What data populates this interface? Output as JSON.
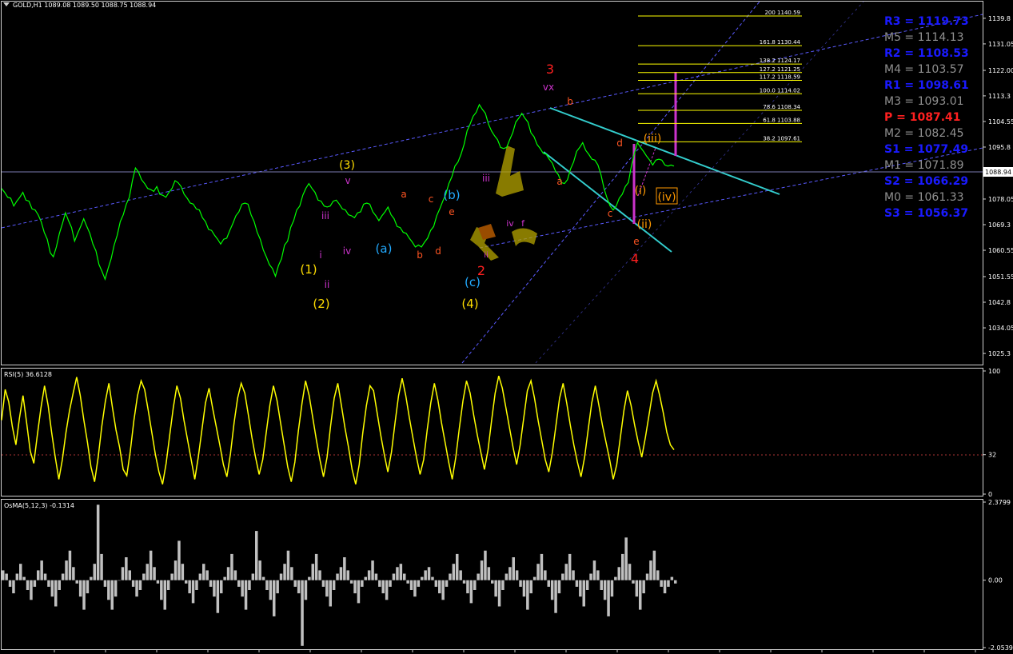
{
  "chart_data": [
    {
      "type": "line",
      "panel": "price",
      "title": "GOLD,H1  1089.08 1089.50 1088.75 1088.94",
      "symbol": "GOLD",
      "timeframe": "H1",
      "ohlc": {
        "open": 1089.08,
        "high": 1089.5,
        "low": 1088.75,
        "close": 1088.94
      },
      "ylim": [
        1021.5,
        1145.5
      ],
      "y_ticks": [
        1139.8,
        1131.05,
        1122.0,
        1113.3,
        1104.55,
        1095.8,
        1086.8,
        1078.05,
        1069.3,
        1060.55,
        1051.55,
        1042.8,
        1034.05,
        1025.3
      ],
      "y_tick_labels": [
        "1139.8",
        "1131.05",
        "1122.00",
        "1113.3",
        "1104.55",
        "1095.8",
        "1086.8",
        "1078.05",
        "1069.3",
        "1060.55",
        "1051.55",
        "1042.8",
        "1034.05",
        "1025.3"
      ],
      "current_price_label": "1088.94",
      "current_price": 1088.94,
      "series": [
        {
          "color": "#00ff00",
          "values": [
            1082,
            1080,
            1079,
            1078,
            1076,
            1077,
            1079,
            1080,
            1078,
            1077,
            1075,
            1074,
            1073,
            1070,
            1067,
            1064,
            1060,
            1058,
            1062,
            1066,
            1070,
            1073,
            1071,
            1068,
            1064,
            1066,
            1069,
            1071,
            1069,
            1066,
            1063,
            1060,
            1056,
            1053,
            1051,
            1054,
            1058,
            1062,
            1066,
            1070,
            1073,
            1076,
            1079,
            1084,
            1089,
            1087,
            1085,
            1083,
            1082,
            1081,
            1081,
            1082,
            1080,
            1079,
            1079,
            1080,
            1082,
            1084,
            1084,
            1082,
            1080,
            1078,
            1077,
            1076,
            1075,
            1074,
            1072,
            1070,
            1068,
            1067,
            1066,
            1064,
            1063,
            1064,
            1065,
            1067,
            1070,
            1072,
            1074,
            1076,
            1077,
            1076,
            1073,
            1070,
            1067,
            1064,
            1061,
            1058,
            1056,
            1054,
            1052,
            1055,
            1058,
            1062,
            1064,
            1068,
            1071,
            1074,
            1076,
            1079,
            1082,
            1083,
            1082,
            1080,
            1078,
            1077,
            1076,
            1075,
            1076,
            1077,
            1078,
            1076,
            1075,
            1074,
            1073,
            1072,
            1072,
            1073,
            1074,
            1076,
            1077,
            1076,
            1074,
            1072,
            1071,
            1072,
            1074,
            1075,
            1073,
            1071,
            1069,
            1068,
            1067,
            1066,
            1065,
            1063,
            1062,
            1062,
            1062,
            1063,
            1065,
            1067,
            1069,
            1072,
            1075,
            1077,
            1080,
            1083,
            1086,
            1089,
            1091,
            1093,
            1097,
            1101,
            1104,
            1106,
            1108,
            1110,
            1109,
            1107,
            1104,
            1101,
            1100,
            1098,
            1096,
            1095,
            1096,
            1098,
            1101,
            1104,
            1106,
            1107,
            1106,
            1104,
            1101,
            1099,
            1097,
            1095,
            1094,
            1093,
            1092,
            1090,
            1088,
            1086,
            1084,
            1083,
            1085,
            1088,
            1091,
            1094,
            1096,
            1097,
            1095,
            1093,
            1092,
            1091,
            1090,
            1086,
            1082,
            1078,
            1076,
            1074,
            1076,
            1078,
            1080,
            1082,
            1084,
            1089,
            1094,
            1097,
            1096,
            1094,
            1093,
            1091,
            1090,
            1091,
            1092,
            1091,
            1090,
            1089,
            1090,
            1089
          ]
        }
      ],
      "fibonacci_levels": [
        {
          "ratio": "200",
          "price": 1140.59
        },
        {
          "ratio": "161.8",
          "price": 1130.44
        },
        {
          "ratio": "138.2",
          "price": 1124.17
        },
        {
          "ratio": "127.2",
          "price": 1121.25
        },
        {
          "ratio": "117.2",
          "price": 1118.59
        },
        {
          "ratio": "100.0",
          "price": 1114.02
        },
        {
          "ratio": "78.6",
          "price": 1108.34
        },
        {
          "ratio": "61.8",
          "price": 1103.88
        },
        {
          "ratio": "38.2",
          "price": 1097.61
        }
      ],
      "fib_line_color": "#ffff00",
      "pivot_levels": [
        {
          "label": "R3",
          "value": "1119.73",
          "color": "#1a1aff"
        },
        {
          "label": "M5",
          "value": "1114.13",
          "color": "#909090"
        },
        {
          "label": "R2",
          "value": "1108.53",
          "color": "#1a1aff"
        },
        {
          "label": "M4",
          "value": "1103.57",
          "color": "#909090"
        },
        {
          "label": "R1",
          "value": "1098.61",
          "color": "#1a1aff"
        },
        {
          "label": "M3",
          "value": "1093.01",
          "color": "#909090"
        },
        {
          "label": "P",
          "value": "1087.41",
          "color": "#ff2020"
        },
        {
          "label": "M2",
          "value": "1082.45",
          "color": "#909090"
        },
        {
          "label": "S1",
          "value": "1077.49",
          "color": "#1a1aff"
        },
        {
          "label": "M1",
          "value": "1071.89",
          "color": "#909090"
        },
        {
          "label": "S2",
          "value": "1066.29",
          "color": "#1a1aff"
        },
        {
          "label": "M0",
          "value": "1061.33",
          "color": "#909090"
        },
        {
          "label": "S3",
          "value": "1056.37",
          "color": "#1a1aff"
        }
      ],
      "wave_labels": [
        {
          "text": "3",
          "color": "#ff2020"
        },
        {
          "text": "vx",
          "color": "#cc33cc"
        },
        {
          "text": "b",
          "color": "#ff5522"
        },
        {
          "text": "(3)",
          "color": "#ffdd00"
        },
        {
          "text": "v",
          "color": "#cc33cc"
        },
        {
          "text": "a",
          "color": "#ff5522"
        },
        {
          "text": "c",
          "color": "#ff5522"
        },
        {
          "text": "(b)",
          "color": "#22aaff"
        },
        {
          "text": "e",
          "color": "#ff5522"
        },
        {
          "text": "iii",
          "color": "#cc33cc"
        },
        {
          "text": "iii",
          "color": "#cc33cc"
        },
        {
          "text": "a",
          "color": "#ff5522"
        },
        {
          "text": "d",
          "color": "#ff5522"
        },
        {
          "text": "(iii)",
          "color": "#ff9900"
        },
        {
          "text": "i",
          "color": "#cc33cc"
        },
        {
          "text": "iv",
          "color": "#cc33cc"
        },
        {
          "text": "(a)",
          "color": "#22aaff"
        },
        {
          "text": "b",
          "color": "#ff5522"
        },
        {
          "text": "d",
          "color": "#ff5522"
        },
        {
          "text": "iv",
          "color": "#cc33cc"
        },
        {
          "text": "f",
          "color": "#cc33cc"
        },
        {
          "text": "(i)",
          "color": "#ff9900"
        },
        {
          "text": "(iv)",
          "color": "#ff9900"
        },
        {
          "text": "c",
          "color": "#ff5522"
        },
        {
          "text": "(ii)",
          "color": "#ff9900"
        },
        {
          "text": "e",
          "color": "#ff5522"
        },
        {
          "text": "4",
          "color": "#ff2020"
        },
        {
          "text": "(1)",
          "color": "#ffdd00"
        },
        {
          "text": "ii",
          "color": "#cc33cc"
        },
        {
          "text": "2",
          "color": "#ff2020"
        },
        {
          "text": "ii",
          "color": "#cc33cc"
        },
        {
          "text": "(c)",
          "color": "#22aaff"
        },
        {
          "text": "(2)",
          "color": "#ffdd00"
        },
        {
          "text": "(4)",
          "color": "#ffdd00"
        }
      ]
    },
    {
      "type": "line",
      "panel": "rsi",
      "title": "RSI(5) 36.6128",
      "period": 5,
      "current_value": 36.6128,
      "ylim": [
        0,
        100
      ],
      "y_tick_labels": [
        "100",
        "32",
        "0"
      ],
      "level": 32,
      "level_label": "32",
      "series": [
        {
          "color": "#ffff00",
          "values": [
            60,
            85,
            75,
            55,
            40,
            62,
            80,
            58,
            35,
            25,
            48,
            70,
            88,
            72,
            50,
            30,
            12,
            28,
            50,
            68,
            82,
            95,
            80,
            60,
            42,
            22,
            10,
            30,
            55,
            75,
            90,
            70,
            52,
            38,
            20,
            15,
            35,
            60,
            80,
            92,
            85,
            68,
            50,
            32,
            18,
            8,
            25,
            48,
            70,
            88,
            78,
            60,
            44,
            28,
            12,
            30,
            52,
            74,
            86,
            70,
            55,
            40,
            24,
            14,
            33,
            58,
            78,
            90,
            82,
            64,
            46,
            30,
            16,
            28,
            50,
            72,
            88,
            76,
            58,
            40,
            22,
            10,
            26,
            52,
            74,
            92,
            80,
            62,
            44,
            28,
            14,
            30,
            56,
            78,
            90,
            72,
            54,
            38,
            20,
            8,
            24,
            50,
            72,
            88,
            84,
            66,
            48,
            32,
            18,
            34,
            58,
            80,
            94,
            80,
            62,
            46,
            30,
            16,
            28,
            52,
            74,
            90,
            76,
            58,
            42,
            26,
            12,
            30,
            54,
            76,
            92,
            82,
            64,
            48,
            34,
            20,
            36,
            60,
            82,
            96,
            86,
            70,
            54,
            38,
            24,
            40,
            62,
            84,
            92,
            78,
            60,
            44,
            28,
            18,
            34,
            56,
            78,
            90,
            74,
            56,
            40,
            26,
            14,
            30,
            52,
            74,
            88,
            72,
            56,
            42,
            28,
            12,
            24,
            46,
            68,
            84,
            72,
            56,
            42,
            30,
            46,
            64,
            82,
            92,
            80,
            66,
            50,
            40,
            36
          ]
        }
      ]
    },
    {
      "type": "bar",
      "panel": "osma",
      "title": "OsMA(5,12,3) -0.1314",
      "params": "5,12,3",
      "current_value": -0.1314,
      "ylim": [
        -2.0539,
        2.3799
      ],
      "y_tick_labels": [
        "2.3799",
        "0.00",
        "-2.0539"
      ],
      "series": [
        {
          "color": "#c0c0c0",
          "values": [
            0.3,
            0.2,
            -0.2,
            -0.4,
            0.2,
            0.5,
            0.1,
            -0.3,
            -0.6,
            -0.2,
            0.3,
            0.6,
            0.2,
            -0.2,
            -0.5,
            -0.8,
            -0.3,
            0.2,
            0.6,
            0.9,
            0.4,
            -0.1,
            -0.5,
            -0.9,
            -0.4,
            0.1,
            0.5,
            2.3,
            0.8,
            -0.2,
            -0.6,
            -0.9,
            -0.5,
            0.0,
            0.4,
            0.7,
            0.3,
            -0.2,
            -0.5,
            -0.3,
            0.2,
            0.5,
            0.9,
            0.4,
            -0.1,
            -0.6,
            -0.9,
            -0.3,
            0.2,
            0.6,
            1.2,
            0.5,
            -0.1,
            -0.4,
            -0.7,
            -0.3,
            0.2,
            0.5,
            0.3,
            -0.2,
            -0.5,
            -1.0,
            -0.4,
            0.1,
            0.4,
            0.8,
            0.3,
            -0.2,
            -0.5,
            -0.9,
            -0.3,
            0.2,
            1.5,
            0.6,
            0.1,
            -0.3,
            -0.6,
            -1.1,
            -0.4,
            0.2,
            0.5,
            0.9,
            0.4,
            -0.2,
            -0.4,
            -2.0,
            -0.6,
            0.1,
            0.5,
            0.8,
            0.3,
            -0.2,
            -0.5,
            -0.8,
            -0.3,
            0.2,
            0.4,
            0.7,
            0.3,
            -0.1,
            -0.4,
            -0.7,
            -0.2,
            0.1,
            0.3,
            0.6,
            0.2,
            -0.2,
            -0.4,
            -0.6,
            -0.2,
            0.2,
            0.4,
            0.5,
            0.2,
            -0.1,
            -0.3,
            -0.5,
            -0.2,
            0.1,
            0.3,
            0.4,
            0.1,
            -0.2,
            -0.4,
            -0.6,
            -0.2,
            0.2,
            0.5,
            0.8,
            0.3,
            -0.1,
            -0.4,
            -0.7,
            -0.3,
            0.2,
            0.6,
            0.9,
            0.4,
            -0.1,
            -0.5,
            -0.8,
            -0.3,
            0.2,
            0.4,
            0.7,
            0.3,
            -0.2,
            -0.5,
            -0.9,
            -0.4,
            0.1,
            0.5,
            0.8,
            0.3,
            -0.2,
            -0.6,
            -1.0,
            -0.4,
            0.2,
            0.5,
            0.8,
            0.3,
            -0.2,
            -0.5,
            -0.8,
            -0.3,
            0.2,
            0.6,
            0.3,
            -0.3,
            -0.6,
            -1.1,
            -0.5,
            0.1,
            0.4,
            0.8,
            1.3,
            0.5,
            -0.1,
            -0.5,
            -0.9,
            -0.4,
            0.2,
            0.6,
            0.9,
            0.3,
            -0.2,
            -0.4,
            -0.2,
            0.1,
            -0.1
          ]
        }
      ]
    }
  ]
}
